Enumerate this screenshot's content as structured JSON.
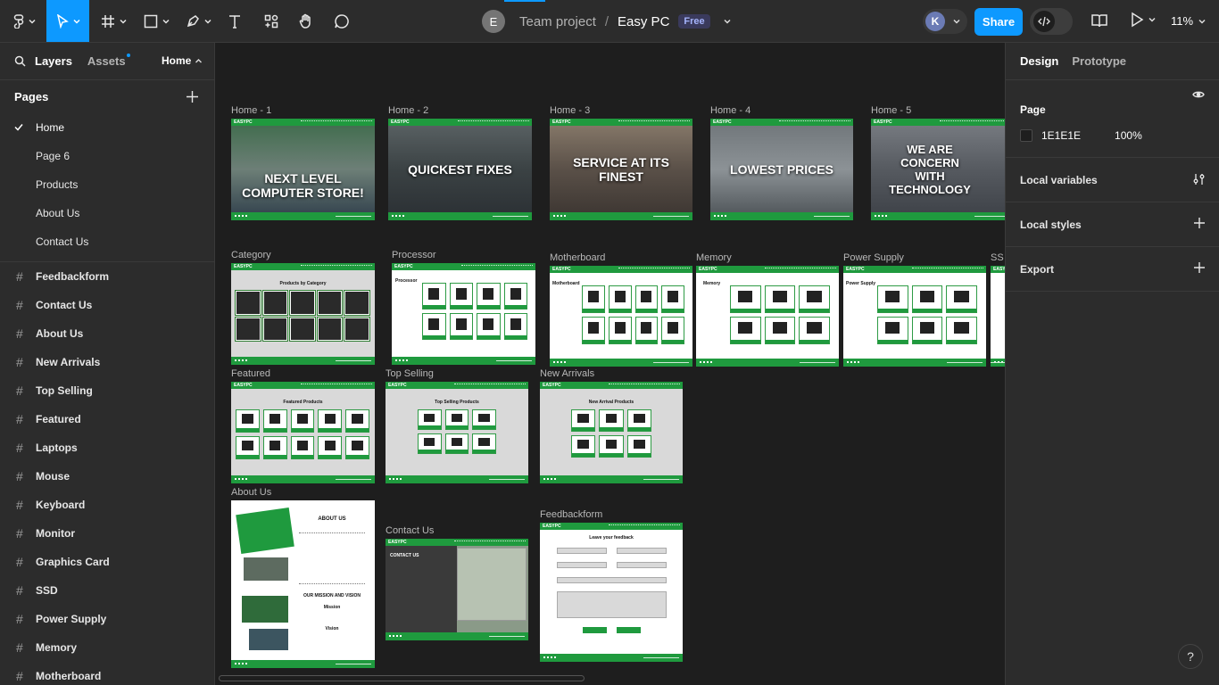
{
  "toolbar": {
    "tools": [
      "main-menu",
      "move",
      "frame",
      "shape",
      "pen",
      "text",
      "resources",
      "hand",
      "comment"
    ],
    "team_avatar": "E",
    "team_name": "Team project",
    "separator": "/",
    "file_name": "Easy PC",
    "plan_badge": "Free",
    "user_avatar": "K",
    "share_label": "Share",
    "zoom": "11%",
    "accent": "#0d99ff"
  },
  "left_panel": {
    "tab_layers": "Layers",
    "tab_assets": "Assets",
    "current_page": "Home",
    "pages_title": "Pages",
    "pages": [
      "Home",
      "Page 6",
      "Products",
      "About Us",
      "Contact Us"
    ],
    "layers": [
      "Feedbackform",
      "Contact Us",
      "About Us",
      "New Arrivals",
      "Top Selling",
      "Featured",
      "Laptops",
      "Mouse",
      "Keyboard",
      "Monitor",
      "Graphics Card",
      "SSD",
      "Power Supply",
      "Memory",
      "Motherboard"
    ]
  },
  "canvas": {
    "background": "#1e1e1e",
    "brand_green": "#1f9a3e",
    "frames": {
      "home1": {
        "label": "Home - 1",
        "hero": "NEXT LEVEL COMPUTER STORE!"
      },
      "home2": {
        "label": "Home - 2",
        "hero": "QUICKEST FIXES"
      },
      "home3": {
        "label": "Home - 3",
        "hero": "SERVICE AT ITS FINEST"
      },
      "home4": {
        "label": "Home - 4",
        "hero": "LOWEST PRICES"
      },
      "home5": {
        "label": "Home - 5",
        "hero": "WE ARE CONCERN WITH TECHNOLOGY"
      },
      "category": {
        "label": "Category",
        "heading": "Products by Category"
      },
      "processor": {
        "label": "Processor",
        "heading": "Processor"
      },
      "motherboard": {
        "label": "Motherboard",
        "heading": "Motherboard"
      },
      "memory": {
        "label": "Memory",
        "heading": "Memory"
      },
      "power_supply": {
        "label": "Power Supply",
        "heading": "Power Supply"
      },
      "ssd": {
        "label": "SS"
      },
      "featured": {
        "label": "Featured",
        "heading": "Featured Products"
      },
      "top_selling": {
        "label": "Top Selling",
        "heading": "Top Selling Products"
      },
      "new_arrivals": {
        "label": "New Arrivals",
        "heading": "New Arrival Products"
      },
      "about_us": {
        "label": "About Us",
        "heading": "ABOUT US",
        "mission_heading": "OUR MISSION AND VISION",
        "mission": "Mission",
        "vision": "Vision"
      },
      "contact_us": {
        "label": "Contact Us",
        "heading": "CONTACT US"
      },
      "feedbackform": {
        "label": "Feedbackform",
        "heading": "Leave your feedback"
      }
    }
  },
  "right_panel": {
    "tab_design": "Design",
    "tab_prototype": "Prototype",
    "page_title": "Page",
    "bg_color": "1E1E1E",
    "bg_opacity": "100%",
    "local_variables": "Local variables",
    "local_styles": "Local styles",
    "export": "Export"
  },
  "help": "?"
}
